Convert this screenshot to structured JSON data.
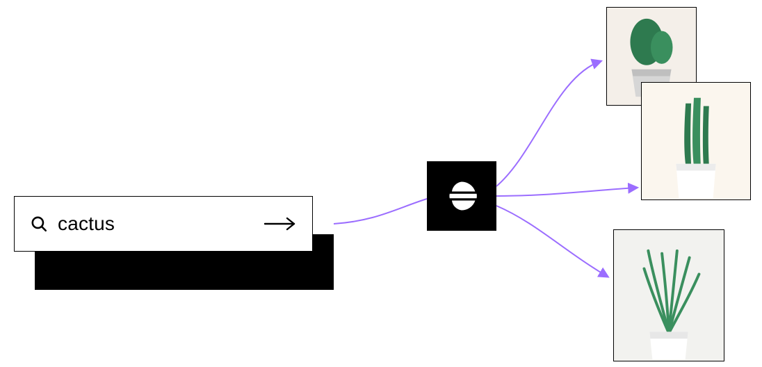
{
  "search": {
    "query": "cactus",
    "icon": "search-icon",
    "submit_icon": "arrow-right-icon"
  },
  "engine": {
    "name": "elasticsearch",
    "icon": "elasticsearch-logo"
  },
  "connectors": {
    "color": "#9b6dff"
  },
  "results": [
    {
      "label": "cactus-image-1",
      "depicts": "potted round cactus in patterned planter"
    },
    {
      "label": "cactus-image-2",
      "depicts": "columnar cactus in white pot"
    },
    {
      "label": "cactus-image-3",
      "depicts": "pencil cactus in white pot"
    }
  ]
}
